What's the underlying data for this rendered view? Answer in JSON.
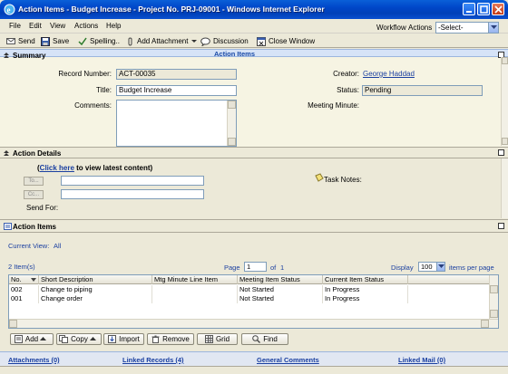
{
  "window": {
    "title": "Action Items - Budget Increase - Project No. PRJ-09001 - Windows Internet Explorer"
  },
  "menu": {
    "items": [
      "File",
      "Edit",
      "View",
      "Actions",
      "Help"
    ],
    "workflow_label": "Workflow",
    "actions_label": "Actions",
    "select_value": "-Select-"
  },
  "toolbar": {
    "send": "Send",
    "save": "Save",
    "spelling": "Spelling..",
    "add_attachment": "Add Attachment",
    "discussion": "Discussion",
    "close_window": "Close Window"
  },
  "header_band": "Action Items",
  "summary": {
    "heading": "Summary",
    "record_number_label": "Record Number:",
    "record_number": "ACT-00035",
    "title_label": "Title:",
    "title": "Budget Increase",
    "comments_label": "Comments:",
    "creator_label": "Creator:",
    "creator": "George Haddad",
    "status_label": "Status:",
    "status": "Pending",
    "meeting_minute_label": "Meeting Minute:"
  },
  "details": {
    "heading": "Action Details",
    "click_here": "Click here",
    "latest_content": " to view latest content)",
    "open_paren": "(",
    "to_btn": "To...",
    "cc_btn": "Cc...",
    "send_for_label": "Send For:",
    "task_notes_label": "Task Notes:"
  },
  "items": {
    "heading": "Action Items",
    "current_view_label": "Current View:",
    "current_view": "All",
    "count": "2 Item(s)",
    "page_label": "Page",
    "page_value": "1",
    "of_label": "of",
    "page_total": "1",
    "display_label": "Display",
    "display_value": "100",
    "per_page_label": "items per page",
    "columns": [
      "No.",
      "Short Description",
      "Mtg Minute Line Item",
      "Meeting Item Status",
      "Current Item Status"
    ],
    "rows": [
      [
        "002",
        "Change to piping",
        "",
        "Not Started",
        "In Progress"
      ],
      [
        "001",
        "Change order",
        "",
        "Not Started",
        "In Progress"
      ]
    ],
    "buttons": {
      "add": "Add",
      "copy": "Copy",
      "import": "Import",
      "remove": "Remove",
      "grid": "Grid",
      "find": "Find"
    }
  },
  "footer": {
    "attachments": "Attachments (0)",
    "linked_records": "Linked Records (4)",
    "general_comments": "General Comments",
    "linked_mail": "Linked Mail (0)"
  }
}
